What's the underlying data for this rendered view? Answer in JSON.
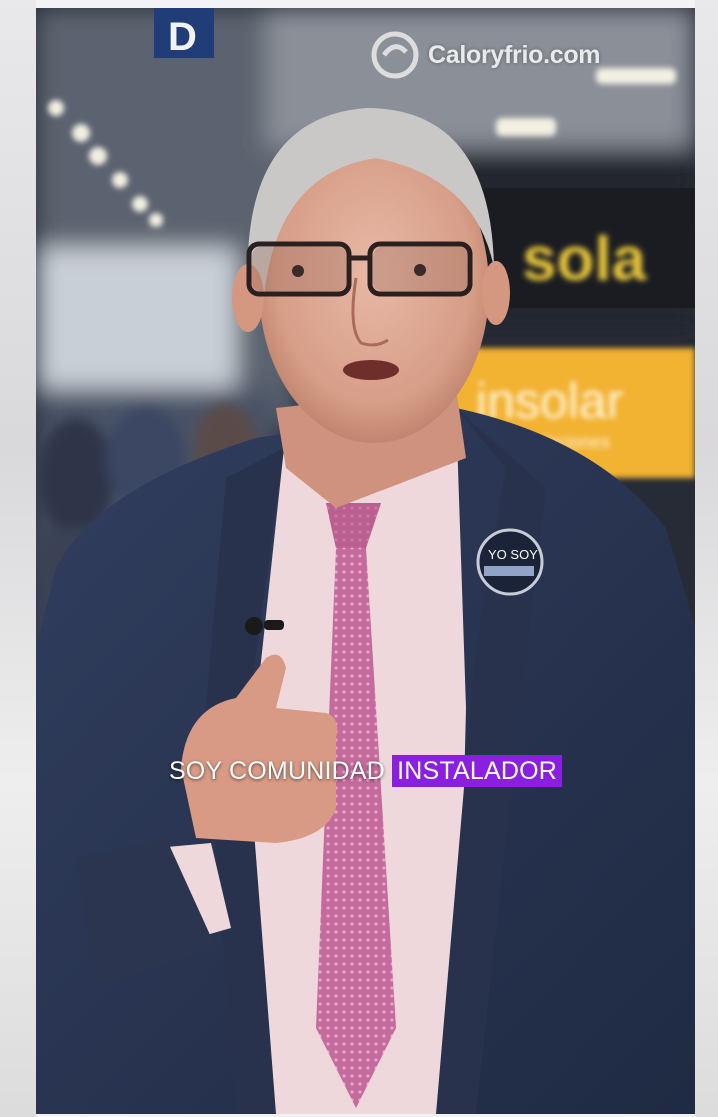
{
  "watermark": {
    "text": "Caloryfrio.com",
    "icon": "caloryfrio-logo-icon"
  },
  "subtitle": {
    "plain": "SOY COMUNIDAD",
    "highlight": "INSTALADOR"
  },
  "booth_signs": {
    "top": "sola",
    "bottom": "insolar",
    "bottom_sub": "instalaciones",
    "hall": "D"
  },
  "badge": {
    "text": "YO SOY"
  },
  "colors": {
    "highlight_bg": "#8a1fe0",
    "suit": "#2a3552",
    "tie": "#c46a9c",
    "shirt": "#efd8dc",
    "booth_yellow": "#f2b233"
  }
}
